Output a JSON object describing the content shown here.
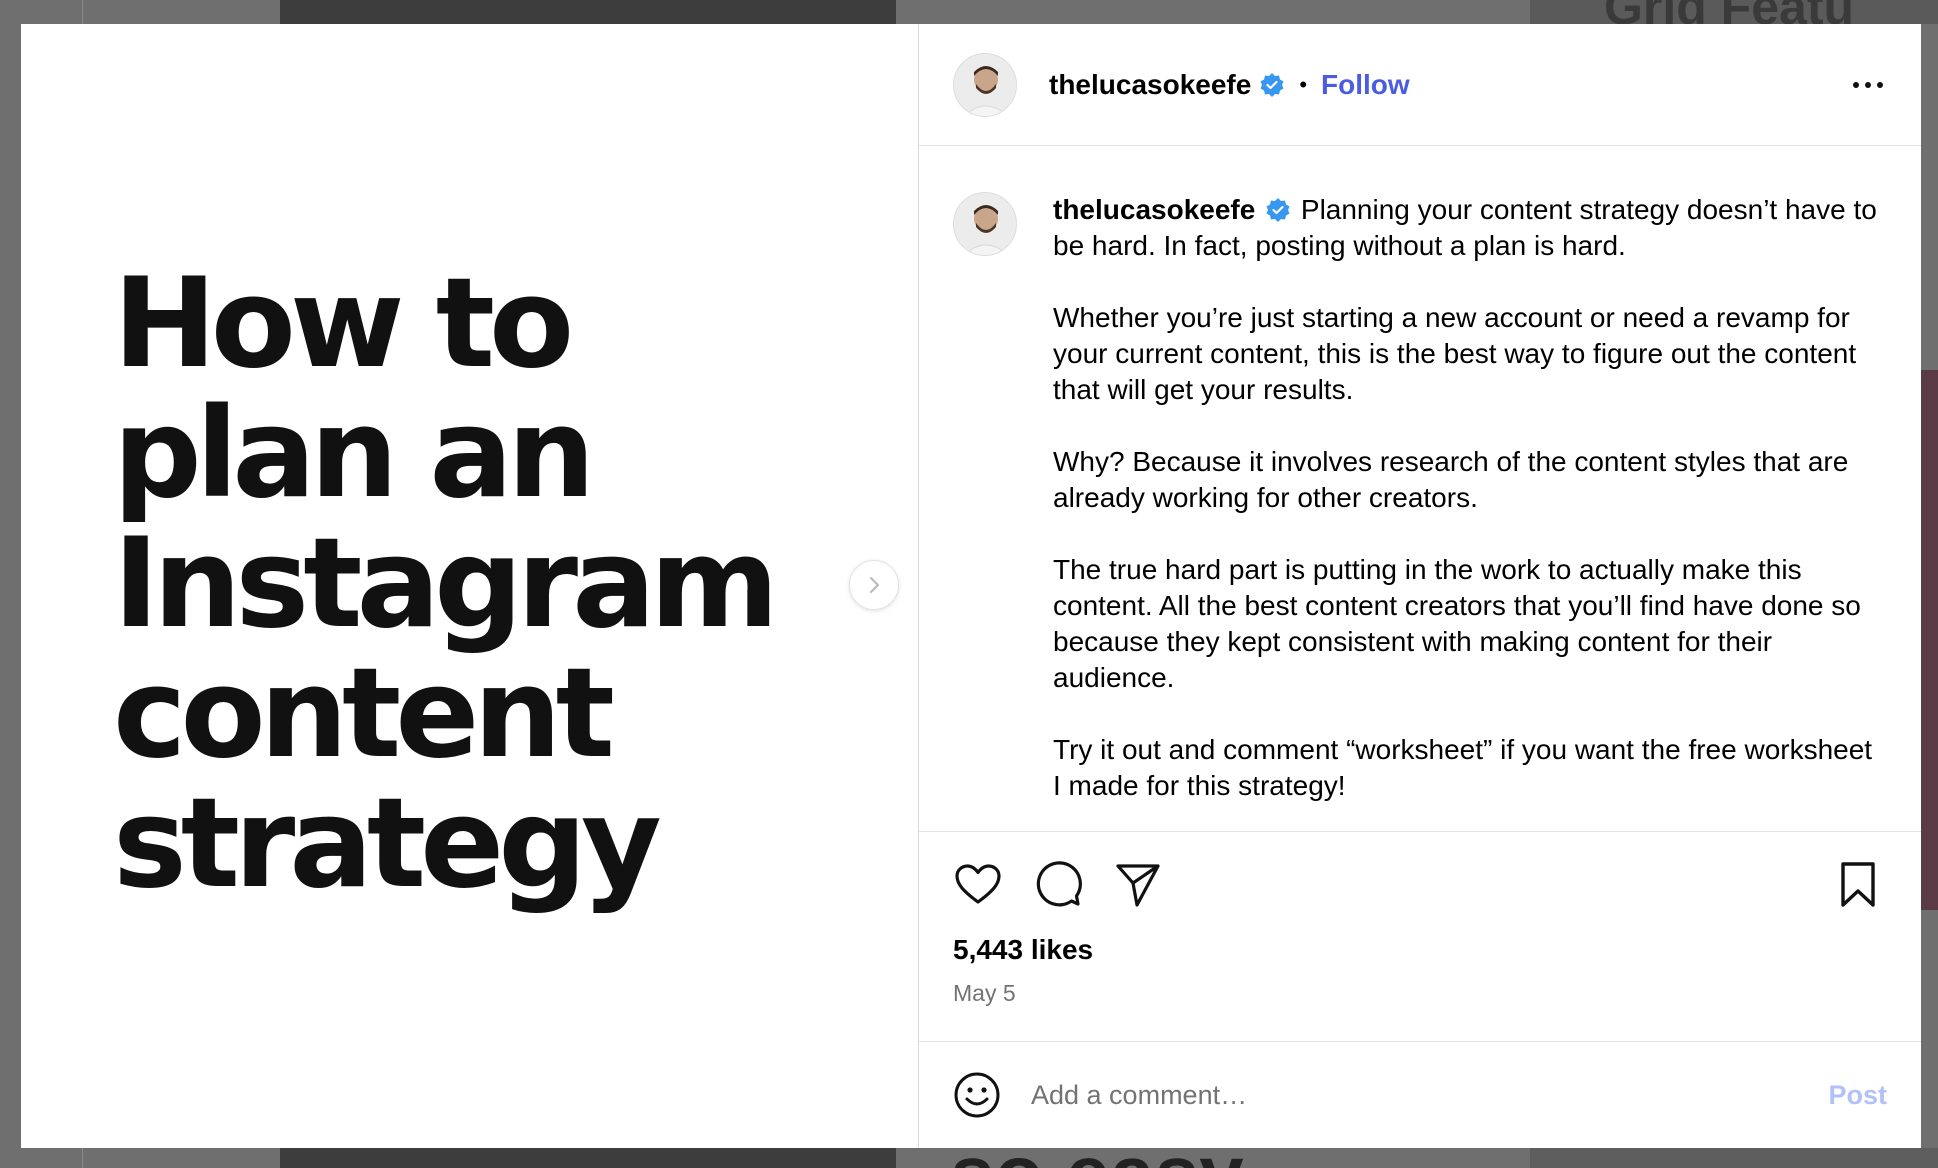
{
  "background": {
    "peek_text_top": "Grid Featu",
    "peek_text_bottom": "so easy"
  },
  "media": {
    "title_lines": [
      "How to",
      "plan an",
      "Instagram",
      "content",
      "strategy"
    ],
    "next_icon": "chevron-right-icon"
  },
  "header": {
    "username": "thelucasokeefe",
    "verified_icon": "verified-badge-icon",
    "separator": "•",
    "follow_label": "Follow",
    "more_icon": "more-horizontal-icon"
  },
  "caption": {
    "username": "thelucasokeefe",
    "paragraphs": [
      "Planning your content strategy doesn’t have to be hard. In fact, posting without a plan is hard.",
      "Whether you’re just starting a new account or need a revamp for your current content, this is the best way to figure out the content that will get your results.",
      "Why? Because it involves research of the content styles that are already working for other creators.",
      "The true hard part is putting in the work to actually make this content. All the best content creators that you’ll find have done so because they kept consistent with making content for their audience.",
      "Try it out and comment “worksheet” if you want the free worksheet I made for this strategy!"
    ]
  },
  "actions": {
    "like_icon": "heart-icon",
    "comment_icon": "comment-icon",
    "share_icon": "send-icon",
    "save_icon": "bookmark-icon",
    "likes": "5,443 likes",
    "date": "May 5"
  },
  "comment": {
    "emoji_icon": "smiley-icon",
    "placeholder": "Add a comment…",
    "post_label": "Post"
  },
  "colors": {
    "accent": "#4a5de0",
    "post_disabled": "#b3c1f6",
    "verified": "#3897f0",
    "muted": "#737373"
  }
}
